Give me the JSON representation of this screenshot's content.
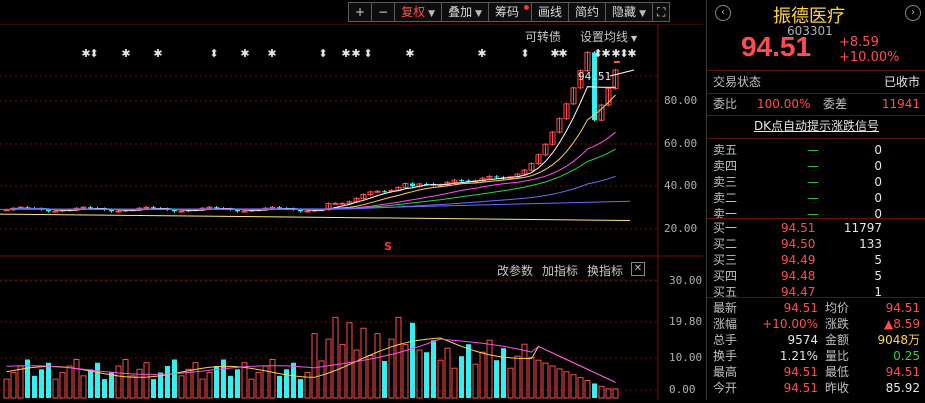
{
  "toolbar": {
    "plus": "+",
    "minus": "−",
    "fuquan": "复权",
    "diejia": "叠加",
    "chouma": "筹码",
    "xianduan": "画线",
    "jianyue": "简约",
    "yincang": "隐藏",
    "expand": "⛶"
  },
  "main_chart": {
    "menu_convertible": "可转债",
    "menu_ma": "设置均线",
    "price_last": "94.51",
    "y_ticks": [
      "80.00",
      "60.00",
      "40.00",
      "20.00"
    ],
    "signal_s": "S"
  },
  "sub_chart": {
    "menu_params": "改参数",
    "menu_add": "加指标",
    "menu_switch": "换指标",
    "y_ticks": [
      "30.00",
      "19.80",
      "10.00",
      "0.00"
    ]
  },
  "colors": {
    "up": "#ff4d4d",
    "down": "#32f0f0",
    "ma5": "#ffffff",
    "ma10": "#ffd34d",
    "ma20": "#ff4df0",
    "ma30": "#2bd24a",
    "ma60": "#6a6aff",
    "ma120": "#ffe680"
  },
  "stock": {
    "name": "振德医疗",
    "code": "603301",
    "price": "94.51",
    "change": "+8.59",
    "change_pct": "+10.00%"
  },
  "status": {
    "label": "交易状态",
    "value": "已收市"
  },
  "weibi": {
    "label": "委比",
    "value": "100.00%",
    "label2": "委差",
    "value2": "11941"
  },
  "signal_link": "DK点自动提示涨跌信号",
  "sell_orders": [
    {
      "label": "卖五",
      "price": "—",
      "vol": "0"
    },
    {
      "label": "卖四",
      "price": "—",
      "vol": "0"
    },
    {
      "label": "卖三",
      "price": "—",
      "vol": "0"
    },
    {
      "label": "卖二",
      "price": "—",
      "vol": "0"
    },
    {
      "label": "卖一",
      "price": "—",
      "vol": "0"
    }
  ],
  "buy_orders": [
    {
      "label": "买一",
      "price": "94.51",
      "vol": "11797"
    },
    {
      "label": "买二",
      "price": "94.50",
      "vol": "133"
    },
    {
      "label": "买三",
      "price": "94.49",
      "vol": "5"
    },
    {
      "label": "买四",
      "price": "94.48",
      "vol": "5"
    },
    {
      "label": "买五",
      "price": "94.47",
      "vol": "1"
    }
  ],
  "quotes": [
    {
      "l1": "最新",
      "v1": "94.51",
      "l2": "均价",
      "v2": "94.51"
    },
    {
      "l1": "涨幅",
      "v1": "+10.00%",
      "l2": "涨跌",
      "v2": "▲8.59"
    },
    {
      "l1": "总手",
      "v1": "9574",
      "l2": "金额",
      "v2": "9048万"
    },
    {
      "l1": "换手",
      "v1": "1.21%",
      "l2": "量比",
      "v2": "0.25"
    },
    {
      "l1": "最高",
      "v1": "94.51",
      "l2": "最低",
      "v2": "94.51"
    },
    {
      "l1": "今开",
      "v1": "94.51",
      "l2": "昨收",
      "v2": "85.92"
    }
  ]
}
